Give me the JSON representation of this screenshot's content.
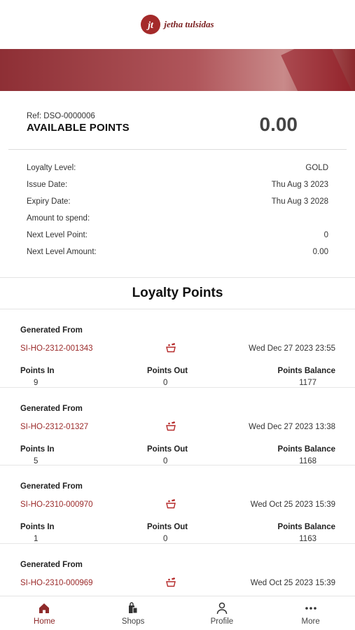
{
  "brand": {
    "name": "jetha tulsidas",
    "mark": "jt",
    "color": "#a42a2a"
  },
  "summary": {
    "ref": "Ref: DSO-0000006",
    "title": "AVAILABLE POINTS",
    "value": "0.00"
  },
  "details": [
    {
      "label": "Loyalty Level:",
      "value": "GOLD"
    },
    {
      "label": "Issue Date:",
      "value": "Thu Aug 3 2023"
    },
    {
      "label": "Expiry Date:",
      "value": "Thu Aug 3 2028"
    },
    {
      "label": "Amount to spend:",
      "value": ""
    },
    {
      "label": "Next Level Point:",
      "value": "0"
    },
    {
      "label": "Next Level Amount:",
      "value": "0.00"
    }
  ],
  "section_title": "Loyalty Points",
  "column_labels": {
    "generated_from": "Generated From",
    "points_in": "Points In",
    "points_out": "Points Out",
    "points_balance": "Points Balance"
  },
  "entries": [
    {
      "invoice": "SI-HO-2312-001343",
      "date": "Wed Dec 27 2023 23:55",
      "points_in": "9",
      "points_out": "0",
      "points_balance": "1177"
    },
    {
      "invoice": "SI-HO-2312-01327",
      "date": "Wed Dec 27 2023 13:38",
      "points_in": "5",
      "points_out": "0",
      "points_balance": "1168"
    },
    {
      "invoice": "SI-HO-2310-000970",
      "date": "Wed Oct 25 2023 15:39",
      "points_in": "1",
      "points_out": "0",
      "points_balance": "1163"
    },
    {
      "invoice": "SI-HO-2310-000969",
      "date": "Wed Oct 25 2023 15:39",
      "points_in": "",
      "points_out": "",
      "points_balance": ""
    }
  ],
  "nav": [
    {
      "label": "Home",
      "icon": "home-icon",
      "active": true
    },
    {
      "label": "Shops",
      "icon": "shopping-bag-icon",
      "active": false
    },
    {
      "label": "Profile",
      "icon": "person-icon",
      "active": false
    },
    {
      "label": "More",
      "icon": "more-dots-icon",
      "active": false
    }
  ],
  "colors": {
    "accent": "#9b2a2a",
    "banner": "#8e2f35"
  }
}
